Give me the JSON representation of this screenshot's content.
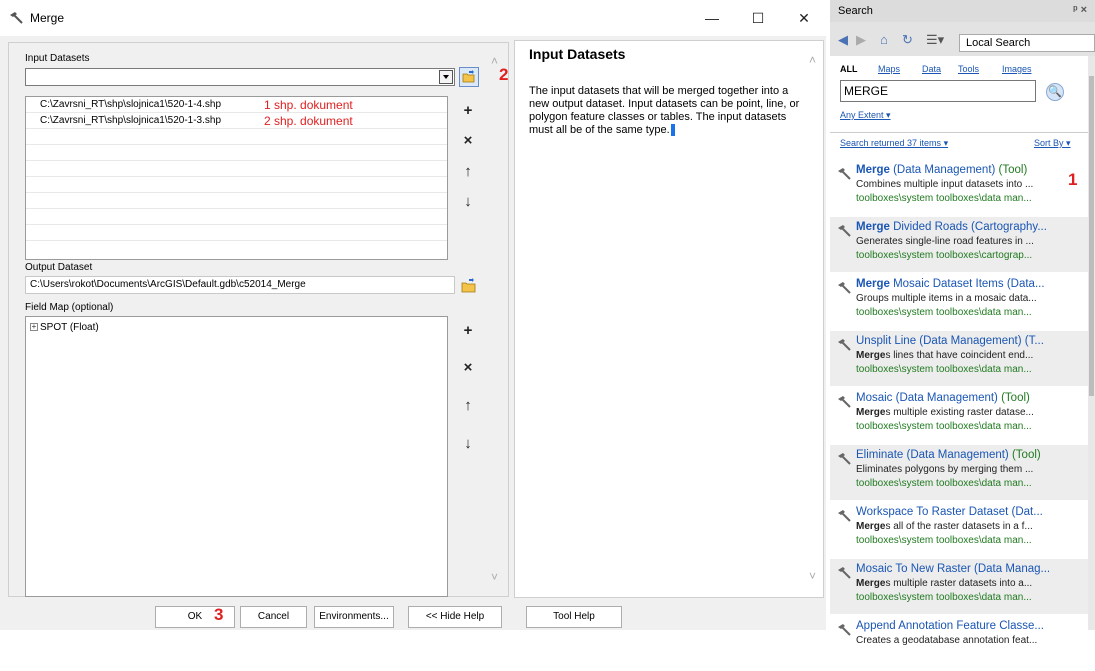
{
  "dialog": {
    "title": "Merge",
    "controls": {
      "minimize": "—",
      "maximize": "☐",
      "close": "✕"
    },
    "input_label": "Input Datasets",
    "inputs": [
      {
        "path": "C:\\Zavrsni_RT\\shp\\slojnica1\\520-1-4.shp",
        "note": "1 shp. dokument"
      },
      {
        "path": "C:\\Zavrsni_RT\\shp\\slojnica1\\520-1-3.shp",
        "note": "2 shp. dokument"
      }
    ],
    "output_label": "Output Dataset",
    "output_value": "C:\\Users\\rokot\\Documents\\ArcGIS\\Default.gdb\\c52014_Merge",
    "fieldmap_label": "Field Map (optional)",
    "fieldmap_item": "SPOT (Float)",
    "tree_expander": "+",
    "side_buttons": {
      "add": "+",
      "remove": "×",
      "up": "↑",
      "down": "↓"
    },
    "marks": {
      "folder": "2",
      "ok": "3",
      "result": "1"
    }
  },
  "help": {
    "title": "Input Datasets",
    "text": "The input datasets that will be merged together into a new output dataset. Input datasets can be point, line, or polygon feature classes or tables. The input datasets must all be of the same type."
  },
  "buttons": {
    "ok": "OK",
    "cancel": "Cancel",
    "environments": "Environments...",
    "hide_help": "<< Hide Help",
    "tool_help": "Tool Help"
  },
  "search": {
    "title": "Search",
    "scope": "Local Search",
    "filters": {
      "all": "ALL",
      "maps": "Maps",
      "data": "Data",
      "tools": "Tools",
      "images": "Images"
    },
    "query": "MERGE",
    "extent": "Any Extent",
    "returned": "Search returned 37 items",
    "sort_by": "Sort By",
    "results": [
      {
        "bold": "Merge",
        "rest": " (Data Management) ",
        "kind": "(Tool)",
        "desc": "Combines multiple input datasets into ...",
        "path": "toolboxes\\system toolboxes\\data man..."
      },
      {
        "bold": "Merge",
        "rest": " Divided Roads (Cartography...",
        "kind": "",
        "desc": "Generates single-line road features in ...",
        "path": "toolboxes\\system toolboxes\\cartograp..."
      },
      {
        "bold": "Merge",
        "rest": " Mosaic Dataset Items (Data...",
        "kind": "",
        "desc": "Groups multiple items in a mosaic data...",
        "path": "toolboxes\\system toolboxes\\data man..."
      },
      {
        "bold": "",
        "rest": "Unsplit Line (Data Management) (T...",
        "kind": "",
        "desc_bold": "Merge",
        "desc": "s lines that have coincident end...",
        "path": "toolboxes\\system toolboxes\\data man..."
      },
      {
        "bold": "",
        "rest": "Mosaic (Data Management) ",
        "kind": "(Tool)",
        "desc_bold": "Merge",
        "desc": "s multiple existing raster datase...",
        "path": "toolboxes\\system toolboxes\\data man..."
      },
      {
        "bold": "",
        "rest": "Eliminate (Data Management) ",
        "kind": "(Tool)",
        "desc": "Eliminates polygons by merging them ...",
        "path": "toolboxes\\system toolboxes\\data man..."
      },
      {
        "bold": "",
        "rest": "Workspace To Raster Dataset (Dat...",
        "kind": "",
        "desc_bold": "Merge",
        "desc": "s all of the raster datasets in a f...",
        "path": "toolboxes\\system toolboxes\\data man..."
      },
      {
        "bold": "",
        "rest": "Mosaic To New Raster (Data Manag...",
        "kind": "",
        "desc_bold": "Merge",
        "desc": "s multiple raster datasets into a...",
        "path": "toolboxes\\system toolboxes\\data man..."
      },
      {
        "bold": "",
        "rest": "Append Annotation Feature Classe...",
        "kind": "",
        "desc": "Creates a geodatabase annotation feat...",
        "path": ""
      }
    ]
  }
}
